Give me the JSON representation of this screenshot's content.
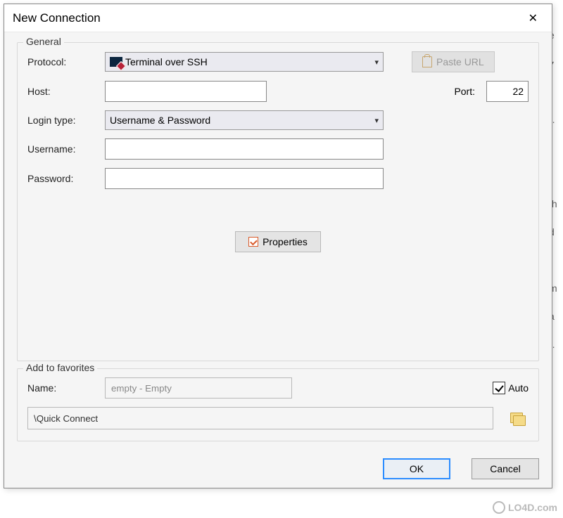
{
  "dialog": {
    "title": "New Connection",
    "general": {
      "legend": "General",
      "protocol_label": "Protocol:",
      "protocol_value": "Terminal over SSH",
      "paste_url_label": "Paste URL",
      "host_label": "Host:",
      "host_value": "",
      "port_label": "Port:",
      "port_value": "22",
      "login_type_label": "Login type:",
      "login_type_value": "Username & Password",
      "username_label": "Username:",
      "username_value": "",
      "password_label": "Password:",
      "password_value": "",
      "properties_label": "Properties"
    },
    "favorites": {
      "legend": "Add to favorites",
      "name_label": "Name:",
      "name_value": "empty - Empty",
      "auto_label": "Auto",
      "auto_checked": true,
      "path_value": "\\Quick Connect"
    },
    "buttons": {
      "ok": "OK",
      "cancel": "Cancel"
    }
  },
  "watermark": "LO4D.com"
}
